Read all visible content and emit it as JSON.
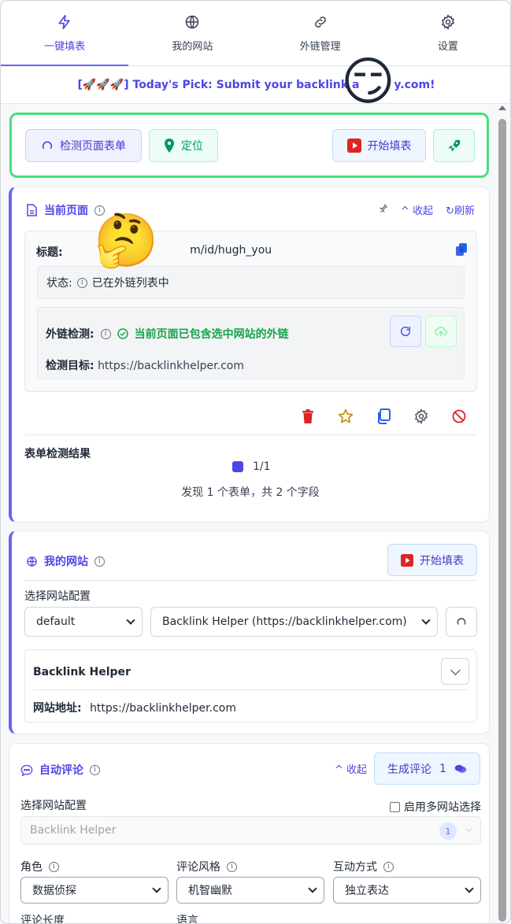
{
  "tabs": [
    {
      "label": "一键填表",
      "icon": "lightning-icon",
      "active": true
    },
    {
      "label": "我的网站",
      "icon": "globe-icon",
      "active": false
    },
    {
      "label": "外链管理",
      "icon": "link-icon",
      "active": false
    },
    {
      "label": "设置",
      "icon": "gear-icon",
      "active": false
    }
  ],
  "banner": {
    "text": "[🚀🚀🚀] Today's Pick: Submit your backlink a",
    "text_tail": "y.com!"
  },
  "toolbar": {
    "detect_label": "检测页面表单",
    "locate_label": "定位",
    "start_label": "开始填表"
  },
  "current_page": {
    "title": "当前页面",
    "pin_icon": "pin-icon",
    "collapse_label": "收起",
    "refresh_label": "刷新",
    "title_label": "标题:",
    "title_value": "m/id/hugh_you",
    "title_prefix": "w",
    "status_label": "状态:",
    "status_value": "已在外链列表中",
    "link_check_label": "外链检测:",
    "link_check_value": "当前页面已包含选中网站的外链",
    "target_label": "检测目标:",
    "target_value": "https://backlinkhelper.com",
    "form_result_title": "表单检测结果",
    "pager": "1/1",
    "summary": "发现 1 个表单，共 2 个字段"
  },
  "my_site": {
    "title": "我的网站",
    "start_label": "开始填表",
    "config_label": "选择网站配置",
    "profile_select": "default",
    "site_select": "Backlink Helper (https://backlinkhelper.com)",
    "site_name": "Backlink Helper",
    "site_url_label": "网站地址:",
    "site_url": "https://backlinkhelper.com"
  },
  "auto_comment": {
    "title": "自动评论",
    "collapse_label": "收起",
    "generate_label": "生成评论",
    "generate_count": "1",
    "config_label": "选择网站配置",
    "multi_site_label": "启用多网站选择",
    "selected_site": "Backlink Helper",
    "selected_count": "1",
    "role_label": "角色",
    "role_value": "数据侦探",
    "style_label": "评论风格",
    "style_value": "机智幽默",
    "interaction_label": "互动方式",
    "interaction_value": "独立表达",
    "length_label": "评论长度",
    "language_label": "语言"
  },
  "colors": {
    "accent": "#4f46e5",
    "success": "#16a34a",
    "toolbar_border": "#4ade80",
    "danger": "#dc2626",
    "star": "#ca8a04"
  }
}
